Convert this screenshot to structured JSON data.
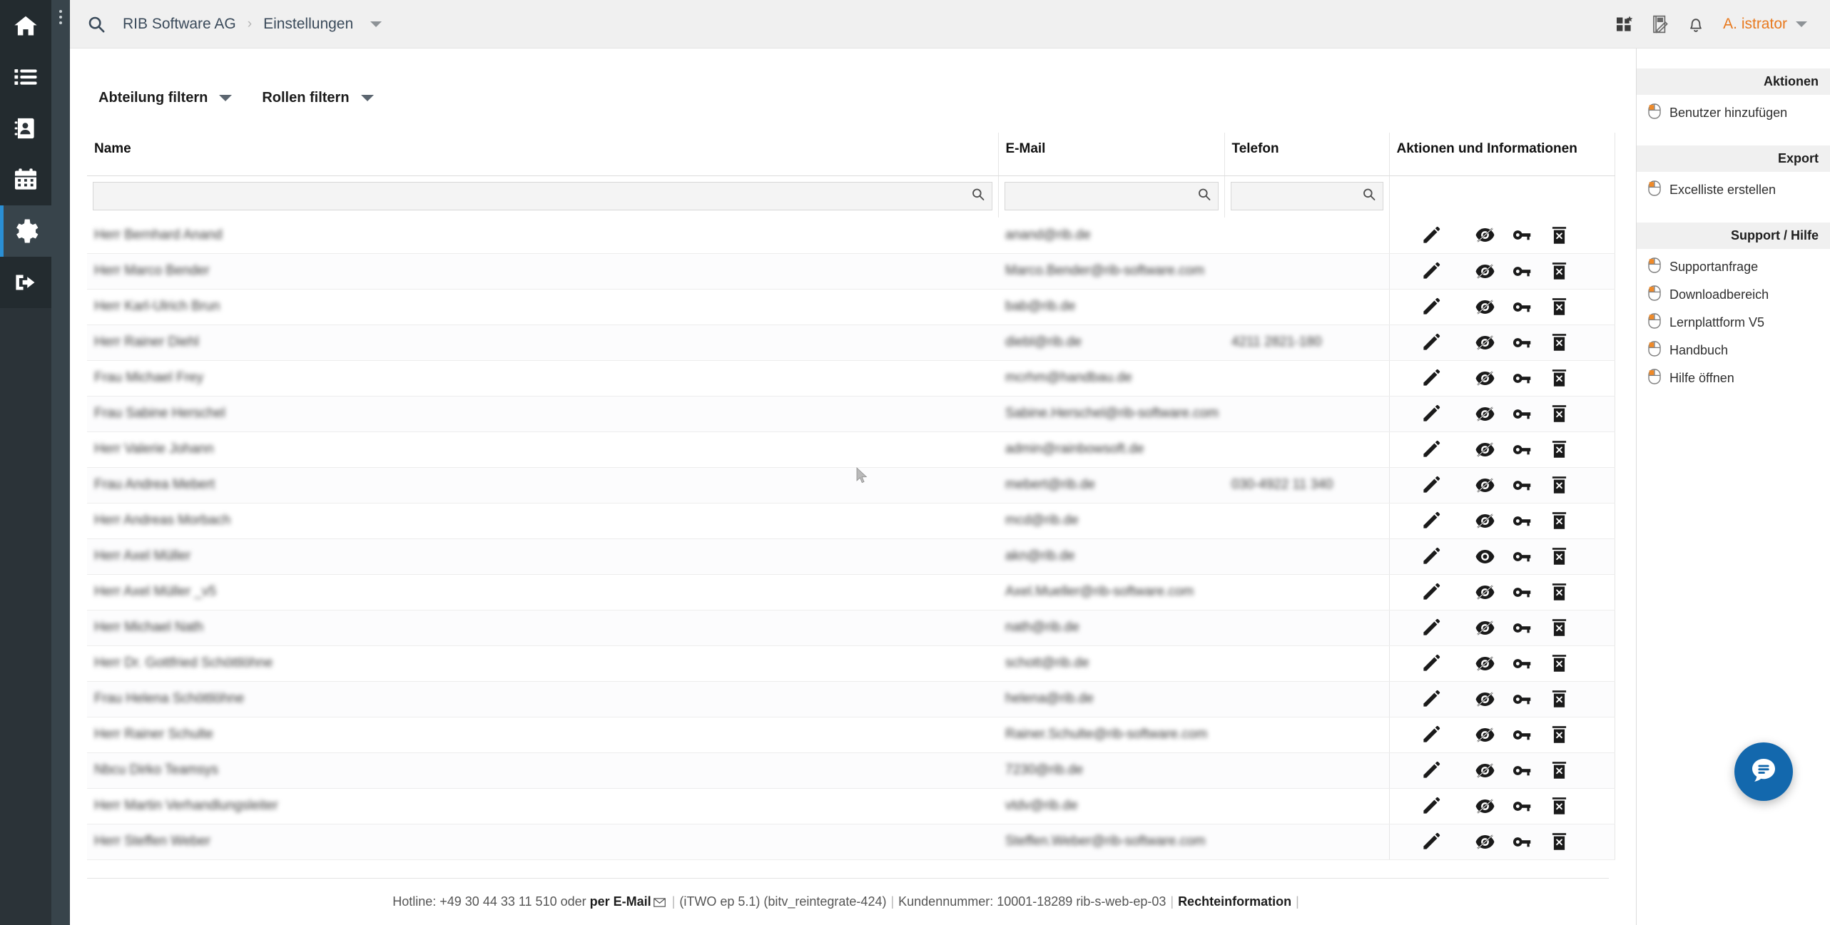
{
  "app": {
    "accent_orange": "#e8791e",
    "accent_blue": "#2a8fd4",
    "rail_bg": "#2b3338",
    "fab_blue": "#1368ad"
  },
  "sidebar": {
    "kebab_label": "more-options",
    "items": [
      {
        "icon": "home-icon",
        "label": "Startseite"
      },
      {
        "icon": "list-icon",
        "label": "Listen"
      },
      {
        "icon": "contacts-icon",
        "label": "Kontakte"
      },
      {
        "icon": "calendar-icon",
        "label": "Kalender"
      },
      {
        "icon": "gear-icon",
        "label": "Einstellungen",
        "active": true
      },
      {
        "icon": "logout-icon",
        "label": "Abmelden"
      }
    ]
  },
  "topbar": {
    "search_icon": "search-icon",
    "breadcrumb": [
      {
        "label": "RIB Software AG"
      },
      {
        "label": "Einstellungen"
      }
    ],
    "separator": "›",
    "right_icons": [
      {
        "name": "apps-grid-icon"
      },
      {
        "name": "notepad-edit-icon"
      },
      {
        "name": "bell-icon"
      }
    ],
    "user": "A. istrator"
  },
  "filters": [
    {
      "label": "Abteilung filtern"
    },
    {
      "label": "Rollen filtern"
    }
  ],
  "table": {
    "columns": [
      {
        "key": "name",
        "label": "Name"
      },
      {
        "key": "mail",
        "label": "E-Mail"
      },
      {
        "key": "tel",
        "label": "Telefon"
      },
      {
        "key": "act",
        "label": "Aktionen und Informationen"
      }
    ],
    "filter_inputs": {
      "name": {
        "value": "",
        "placeholder": ""
      },
      "mail": {
        "value": "",
        "placeholder": ""
      },
      "tel": {
        "value": "",
        "placeholder": ""
      }
    },
    "action_icons": {
      "edit": "pencil-icon",
      "visible": "eye-icon",
      "hidden": "eye-slash-icon",
      "password": "key-icon",
      "delete": "trash-icon"
    },
    "rows": [
      {
        "name": "Herr Bernhard Anand",
        "mail": "anand@rib.de",
        "tel": "",
        "visible": false
      },
      {
        "name": "Herr Marco Bender",
        "mail": "Marco.Bender@rib-software.com",
        "tel": "",
        "visible": false
      },
      {
        "name": "Herr Karl-Ulrich Brun",
        "mail": "bab@rib.de",
        "tel": "",
        "visible": false
      },
      {
        "name": "Herr Rainer Diehl",
        "mail": "diebl@rib.de",
        "tel": "4211 2821-180",
        "visible": false
      },
      {
        "name": "Frau Michael Frey",
        "mail": "mcrhm@handbau.de",
        "tel": "",
        "visible": false
      },
      {
        "name": "Frau Sabine Herschel",
        "mail": "Sabine.Herschel@rib-software.com",
        "tel": "",
        "visible": false
      },
      {
        "name": "Herr Valerie Johann",
        "mail": "admin@rainbowsoft.de",
        "tel": "",
        "visible": false
      },
      {
        "name": "Frau Andrea Mebert",
        "mail": "mebert@rib.de",
        "tel": "030-4922 11 340",
        "visible": false
      },
      {
        "name": "Herr Andreas Morbach",
        "mail": "mcd@rib.de",
        "tel": "",
        "visible": false
      },
      {
        "name": "Herr Axel Müller",
        "mail": "akn@rib.de",
        "tel": "",
        "visible": true
      },
      {
        "name": "Herr Axel Müller _v5",
        "mail": "Axel.Mueller@rib-software.com",
        "tel": "",
        "visible": false
      },
      {
        "name": "Herr Michael Nath",
        "mail": "nath@rib.de",
        "tel": "",
        "visible": false
      },
      {
        "name": "Herr Dr. Gottfried Schöttlöhne",
        "mail": "schott@rib.de",
        "tel": "",
        "visible": false
      },
      {
        "name": "Frau Helena Schöttlöhne",
        "mail": "helena@rib.de",
        "tel": "",
        "visible": false
      },
      {
        "name": "Herr Rainer Schulte",
        "mail": "Rainer.Schulte@rib-software.com",
        "tel": "",
        "visible": false
      },
      {
        "name": "Nbcu Dirko Teamsys",
        "mail": "7230@rib.de",
        "tel": "",
        "visible": false
      },
      {
        "name": "Herr Martin Verhandlungsleiter",
        "mail": "vtdv@rib.de",
        "tel": "",
        "visible": false
      },
      {
        "name": "Herr Steffen Weber",
        "mail": "Steffen.Weber@rib-software.com",
        "tel": "",
        "visible": false
      }
    ]
  },
  "right_panel": {
    "sections": [
      {
        "title": "Aktionen",
        "items": [
          {
            "icon": "mouse-icon",
            "label": "Benutzer hinzufügen"
          }
        ]
      },
      {
        "title": "Export",
        "items": [
          {
            "icon": "mouse-icon",
            "label": "Excelliste erstellen"
          }
        ]
      },
      {
        "title": "Support / Hilfe",
        "items": [
          {
            "icon": "mouse-icon",
            "label": "Supportanfrage"
          },
          {
            "icon": "mouse-icon",
            "label": "Downloadbereich"
          },
          {
            "icon": "mouse-icon",
            "label": "Lernplattform V5"
          },
          {
            "icon": "mouse-icon",
            "label": "Handbuch"
          },
          {
            "icon": "mouse-icon",
            "label": "Hilfe öffnen"
          }
        ]
      }
    ]
  },
  "footer": {
    "hotline_prefix": "Hotline: +49 30 44 33 11 510 oder ",
    "mail_link": "per E-Mail",
    "mail_icon": "envelope-icon",
    "version": "(iTWO ep 5.1) (bitv_reintegrate-424)",
    "customer": "Kundennummer: 10001-18289 rib-s-web-ep-03",
    "legal": "Rechteinformation",
    "separator": "|"
  },
  "fab": {
    "icon": "chat-bubble-icon",
    "label": "Chat"
  }
}
